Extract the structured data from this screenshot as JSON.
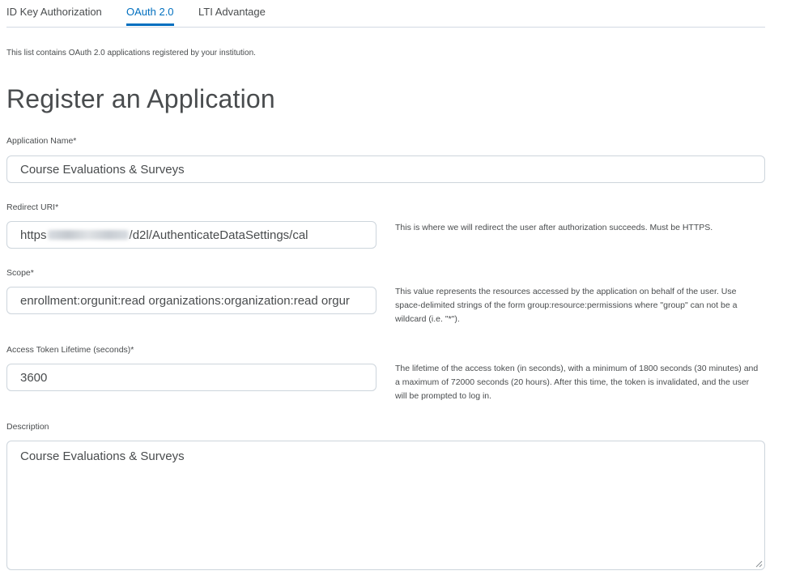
{
  "tabs": [
    {
      "label": "ID Key Authorization",
      "active": false
    },
    {
      "label": "OAuth 2.0",
      "active": true
    },
    {
      "label": "LTI Advantage",
      "active": false
    }
  ],
  "intro_text": "This list contains OAuth 2.0 applications registered by your institution.",
  "page_title": "Register an Application",
  "form": {
    "app_name": {
      "label": "Application Name*",
      "value": "Course Evaluations & Surveys"
    },
    "redirect_uri": {
      "label": "Redirect URI*",
      "value_prefix": "https",
      "value_suffix": "/d2l/AuthenticateDataSettings/cal",
      "help": "This is where we will redirect the user after authorization succeeds. Must be HTTPS."
    },
    "scope": {
      "label": "Scope*",
      "value": "enrollment:orgunit:read organizations:organization:read orgur",
      "help": "This value represents the resources accessed by the application on behalf of the user. Use space-delimited strings of the form group:resource:permissions where \"group\" can not be a wildcard (i.e. \"*\")."
    },
    "token_lifetime": {
      "label": "Access Token Lifetime (seconds)*",
      "value": "3600",
      "help": "The lifetime of the access token (in seconds), with a minimum of 1800 seconds (30 minutes) and a maximum of 72000 seconds (20 hours). After this time, the token is invalidated, and the user will be prompted to log in."
    },
    "description": {
      "label": "Description",
      "value": "Course Evaluations & Surveys"
    }
  },
  "colors": {
    "accent": "#006fbf",
    "text": "#494c4e",
    "border": "#cdd5dc"
  }
}
